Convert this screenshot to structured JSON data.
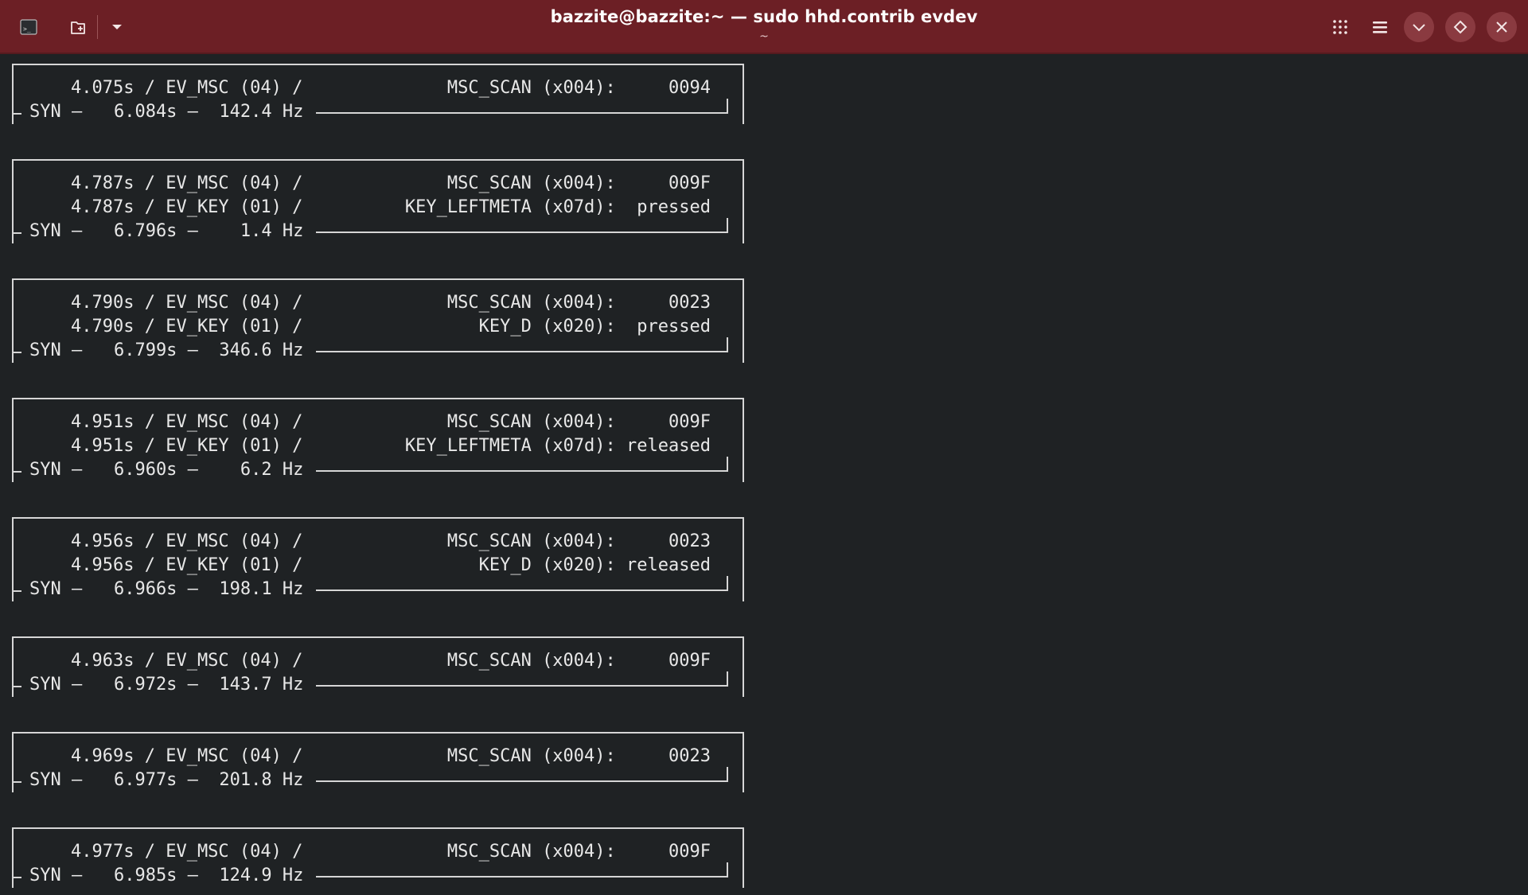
{
  "window": {
    "title": "bazzite@bazzite:~ — sudo hhd.contrib evdev",
    "subtitle": "~"
  },
  "icons": {
    "terminal": "terminal-icon",
    "new_tab": "new-tab-icon",
    "dropdown": "chevron-down-icon",
    "grid": "grid-icon",
    "menu": "hamburger-menu-icon",
    "minimize": "minimize-icon",
    "maximize": "maximize-icon",
    "close": "close-icon"
  },
  "colors": {
    "headerbar": "#6c1f25",
    "terminal_bg": "#1f2224",
    "text": "#e8e8e8"
  },
  "events": [
    {
      "rows": [
        {
          "ts": "4.075s / EV_MSC (04) /",
          "code": "MSC_SCAN (x004):     0094"
        }
      ],
      "syn": "SYN —   6.084s —  142.4 Hz"
    },
    {
      "rows": [
        {
          "ts": "4.787s / EV_MSC (04) /",
          "code": "MSC_SCAN (x004):     009F"
        },
        {
          "ts": "4.787s / EV_KEY (01) /",
          "code": "KEY_LEFTMETA (x07d):  pressed"
        }
      ],
      "syn": "SYN —   6.796s —    1.4 Hz"
    },
    {
      "rows": [
        {
          "ts": "4.790s / EV_MSC (04) /",
          "code": "MSC_SCAN (x004):     0023"
        },
        {
          "ts": "4.790s / EV_KEY (01) /",
          "code": "KEY_D (x020):  pressed"
        }
      ],
      "syn": "SYN —   6.799s —  346.6 Hz"
    },
    {
      "rows": [
        {
          "ts": "4.951s / EV_MSC (04) /",
          "code": "MSC_SCAN (x004):     009F"
        },
        {
          "ts": "4.951s / EV_KEY (01) /",
          "code": "KEY_LEFTMETA (x07d): released"
        }
      ],
      "syn": "SYN —   6.960s —    6.2 Hz"
    },
    {
      "rows": [
        {
          "ts": "4.956s / EV_MSC (04) /",
          "code": "MSC_SCAN (x004):     0023"
        },
        {
          "ts": "4.956s / EV_KEY (01) /",
          "code": "KEY_D (x020): released"
        }
      ],
      "syn": "SYN —   6.966s —  198.1 Hz"
    },
    {
      "rows": [
        {
          "ts": "4.963s / EV_MSC (04) /",
          "code": "MSC_SCAN (x004):     009F"
        }
      ],
      "syn": "SYN —   6.972s —  143.7 Hz"
    },
    {
      "rows": [
        {
          "ts": "4.969s / EV_MSC (04) /",
          "code": "MSC_SCAN (x004):     0023"
        }
      ],
      "syn": "SYN —   6.977s —  201.8 Hz"
    },
    {
      "rows": [
        {
          "ts": "4.977s / EV_MSC (04) /",
          "code": "MSC_SCAN (x004):     009F"
        }
      ],
      "syn": "SYN —   6.985s —  124.9 Hz"
    }
  ]
}
